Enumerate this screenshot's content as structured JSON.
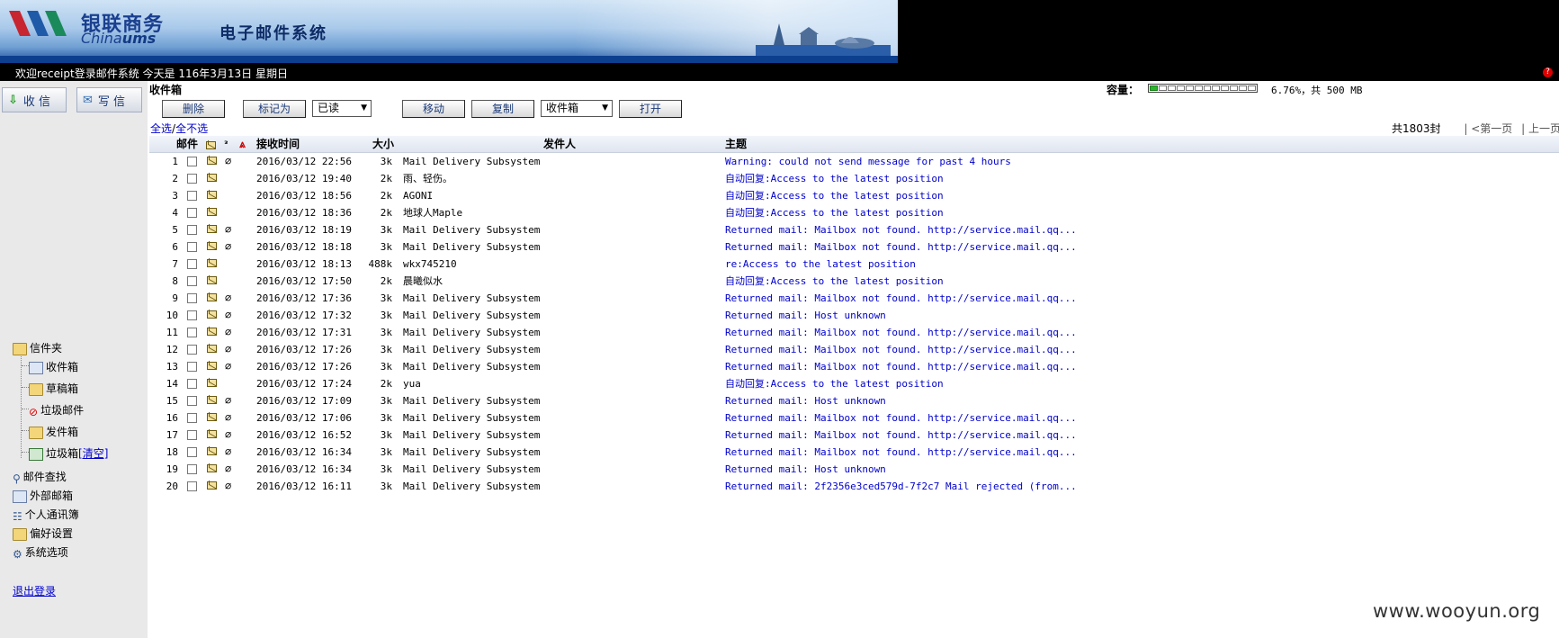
{
  "header": {
    "logo_cn": "银联商务",
    "logo_en_prefix": "China",
    "logo_en_brand": "ums",
    "system_title": "电子邮件系统",
    "welcome": "欢迎receipt登录邮件系统 今天是 116年3月13日 星期日"
  },
  "sidebar": {
    "receive_label": "收 信",
    "compose_label": "写 信",
    "folders_label": "信件夹",
    "inbox_label": "收件箱",
    "drafts_label": "草稿箱",
    "spam_label": "垃圾邮件",
    "sent_label": "发件箱",
    "trash_label": "垃圾箱",
    "trash_clear": "[清空]",
    "search_label": "邮件查找",
    "external_label": "外部邮箱",
    "contacts_label": "个人通讯簿",
    "prefs_label": "偏好设置",
    "options_label": "系统选项",
    "logout_label": "退出登录"
  },
  "main": {
    "folder_title": "收件箱",
    "capacity_label": "容量：",
    "capacity_text": "6.76%，共 500 MB",
    "capacity_fraction": 0.0676,
    "toolbar": {
      "delete": "删除",
      "mark_as": "标记为",
      "mark_select": "已读",
      "move": "移动",
      "copy": "复制",
      "folder_select": "收件箱",
      "open": "打开"
    },
    "select_all": "全选",
    "select_none": "全不选",
    "total": "共1803封",
    "first_page": "<第一页",
    "prev_page": "上一页",
    "columns": {
      "mail": "邮件",
      "time": "接收时间",
      "size": "大小",
      "sender": "发件人",
      "subject": "主题"
    }
  },
  "rows": [
    {
      "n": "1",
      "time": "2016/03/12 22:56",
      "size": "3k",
      "from": "Mail Delivery Subsystem",
      "subject": "Warning: could not send message for past 4 hours",
      "attach": true
    },
    {
      "n": "2",
      "time": "2016/03/12 19:40",
      "size": "2k",
      "from": "雨、轻伤。",
      "subject": "自动回复:Access to the latest position",
      "attach": false
    },
    {
      "n": "3",
      "time": "2016/03/12 18:56",
      "size": "2k",
      "from": "AGONI",
      "subject": "自动回复:Access to the latest position",
      "attach": false
    },
    {
      "n": "4",
      "time": "2016/03/12 18:36",
      "size": "2k",
      "from": "地球人Maple",
      "subject": "自动回复:Access to the latest position",
      "attach": false
    },
    {
      "n": "5",
      "time": "2016/03/12 18:19",
      "size": "3k",
      "from": "Mail Delivery Subsystem",
      "subject": "Returned mail: Mailbox not found. http://service.mail.qq...",
      "attach": true
    },
    {
      "n": "6",
      "time": "2016/03/12 18:18",
      "size": "3k",
      "from": "Mail Delivery Subsystem",
      "subject": "Returned mail: Mailbox not found. http://service.mail.qq...",
      "attach": true
    },
    {
      "n": "7",
      "time": "2016/03/12 18:13",
      "size": "488k",
      "from": "wkx745210",
      "subject": "re:Access to the latest position",
      "attach": false
    },
    {
      "n": "8",
      "time": "2016/03/12 17:50",
      "size": "2k",
      "from": "晨曦似水",
      "subject": "自动回复:Access to the latest position",
      "attach": false
    },
    {
      "n": "9",
      "time": "2016/03/12 17:36",
      "size": "3k",
      "from": "Mail Delivery Subsystem",
      "subject": "Returned mail: Mailbox not found. http://service.mail.qq...",
      "attach": true
    },
    {
      "n": "10",
      "time": "2016/03/12 17:32",
      "size": "3k",
      "from": "Mail Delivery Subsystem",
      "subject": "Returned mail: Host unknown",
      "attach": true
    },
    {
      "n": "11",
      "time": "2016/03/12 17:31",
      "size": "3k",
      "from": "Mail Delivery Subsystem",
      "subject": "Returned mail: Mailbox not found. http://service.mail.qq...",
      "attach": true
    },
    {
      "n": "12",
      "time": "2016/03/12 17:26",
      "size": "3k",
      "from": "Mail Delivery Subsystem",
      "subject": "Returned mail: Mailbox not found. http://service.mail.qq...",
      "attach": true
    },
    {
      "n": "13",
      "time": "2016/03/12 17:26",
      "size": "3k",
      "from": "Mail Delivery Subsystem",
      "subject": "Returned mail: Mailbox not found. http://service.mail.qq...",
      "attach": true
    },
    {
      "n": "14",
      "time": "2016/03/12 17:24",
      "size": "2k",
      "from": "yua",
      "subject": "自动回复:Access to the latest position",
      "attach": false
    },
    {
      "n": "15",
      "time": "2016/03/12 17:09",
      "size": "3k",
      "from": "Mail Delivery Subsystem",
      "subject": "Returned mail: Host unknown",
      "attach": true
    },
    {
      "n": "16",
      "time": "2016/03/12 17:06",
      "size": "3k",
      "from": "Mail Delivery Subsystem",
      "subject": "Returned mail: Mailbox not found. http://service.mail.qq...",
      "attach": true
    },
    {
      "n": "17",
      "time": "2016/03/12 16:52",
      "size": "3k",
      "from": "Mail Delivery Subsystem",
      "subject": "Returned mail: Mailbox not found. http://service.mail.qq...",
      "attach": true
    },
    {
      "n": "18",
      "time": "2016/03/12 16:34",
      "size": "3k",
      "from": "Mail Delivery Subsystem",
      "subject": "Returned mail: Mailbox not found. http://service.mail.qq...",
      "attach": true
    },
    {
      "n": "19",
      "time": "2016/03/12 16:34",
      "size": "3k",
      "from": "Mail Delivery Subsystem",
      "subject": "Returned mail: Host unknown",
      "attach": true
    },
    {
      "n": "20",
      "time": "2016/03/12 16:11",
      "size": "3k",
      "from": "Mail Delivery Subsystem",
      "subject": "Returned mail: 2f2356e3ced579d-7f2c7 Mail rejected (from...",
      "attach": true
    }
  ],
  "watermark": "www.wooyun.org",
  "icons": {
    "envelope": "envelope-icon",
    "attachment": "paperclip-icon",
    "priority": "priority-icon",
    "help": "help-icon"
  }
}
